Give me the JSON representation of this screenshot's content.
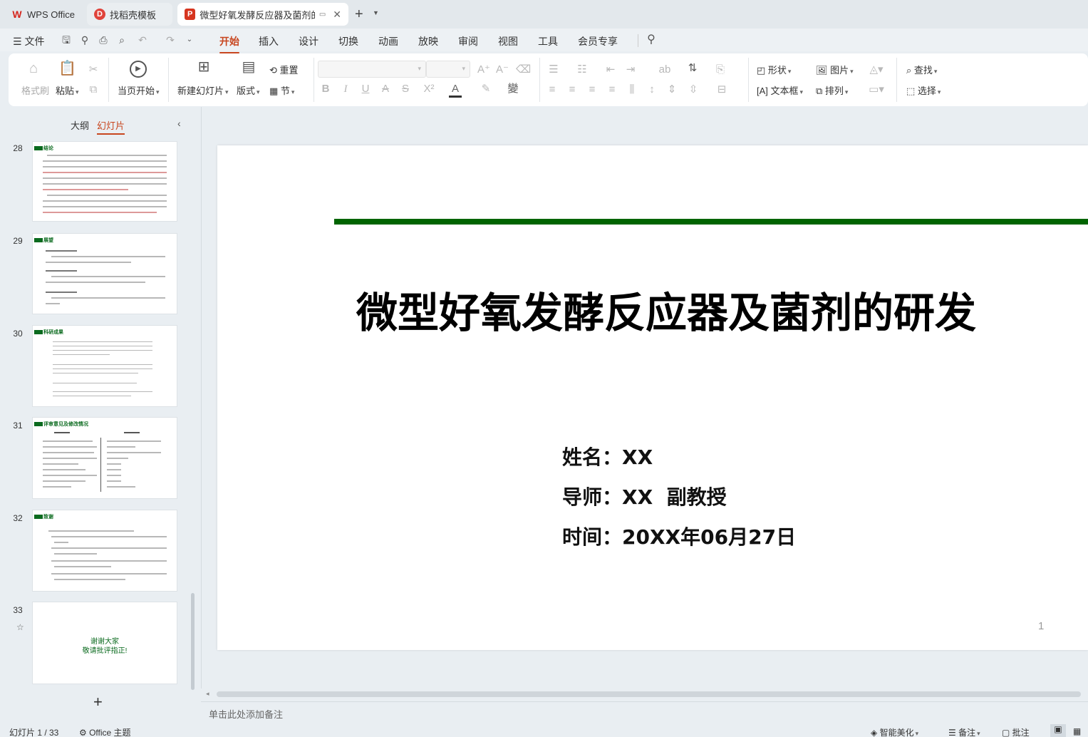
{
  "titlebar": {
    "tabs": [
      {
        "label": "WPS Office",
        "icon": "wps-logo-icon"
      },
      {
        "label": "找稻壳模板",
        "icon": "docer-icon"
      },
      {
        "label": "微型好氧发酵反应器及菌剂的研",
        "icon": "ppt-file-icon"
      }
    ],
    "new_tab": "+"
  },
  "menu": {
    "file_label": "文件",
    "tabs": [
      "开始",
      "插入",
      "设计",
      "切换",
      "动画",
      "放映",
      "审阅",
      "视图",
      "工具",
      "会员专享"
    ],
    "active_tab": "开始"
  },
  "ribbon": {
    "format_painter": "格式刷",
    "paste": "粘贴",
    "from_current": "当页开始",
    "new_slide": "新建幻灯片",
    "layout": "版式",
    "reset": "重置",
    "section": "节",
    "shape": "形状",
    "picture": "图片",
    "find": "查找",
    "textbox": "文本框",
    "arrange": "排列",
    "select": "选择",
    "bold": "B",
    "italic": "I",
    "underline": "U",
    "strike": "A",
    "strike2": "S",
    "superscript": "X²",
    "font_color": "A"
  },
  "panel": {
    "outline_tab": "大纲",
    "slides_tab": "幻灯片",
    "add": "+"
  },
  "thumbnails": [
    {
      "num": "28",
      "title": "结论"
    },
    {
      "num": "29",
      "title": "展望"
    },
    {
      "num": "30",
      "title": "科研成果"
    },
    {
      "num": "31",
      "title": "评审意见及修改情况"
    },
    {
      "num": "32",
      "title": "致谢"
    },
    {
      "num": "33",
      "title": "",
      "line1": "谢谢大家",
      "line2": "敬请批评指正!"
    }
  ],
  "slide": {
    "title": "微型好氧发酵反应器及菌剂的研发",
    "name_line": "姓名：XX",
    "advisor_line": "导师：XX  副教授",
    "date_line": "时间：20XX年06月27日",
    "page_number": "1",
    "accent_color": "#006400"
  },
  "notes_placeholder": "单击此处添加备注",
  "status": {
    "slide_count": "幻灯片 1 / 33",
    "theme": "Office 主题",
    "beautify": "智能美化",
    "notes": "备注",
    "comments": "批注"
  }
}
